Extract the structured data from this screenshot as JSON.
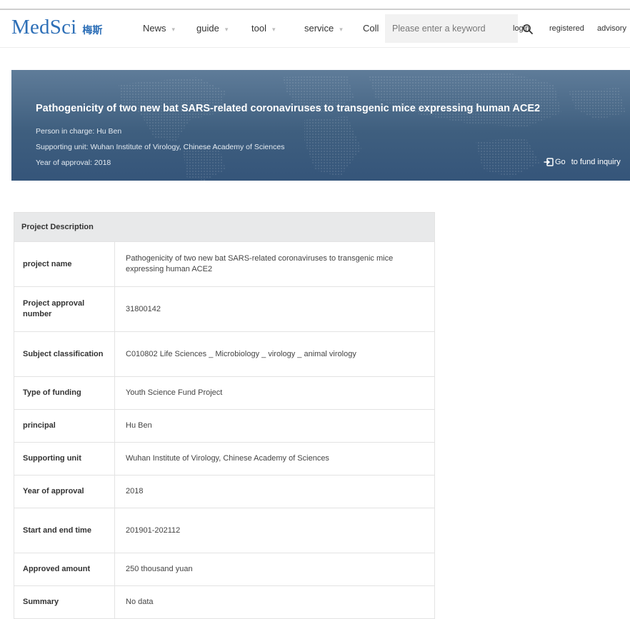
{
  "brand": {
    "name": "MedSci",
    "cn": "梅斯"
  },
  "nav": {
    "items": [
      {
        "label": "News",
        "caret": "▾"
      },
      {
        "label": "guide",
        "caret": "▾"
      },
      {
        "label": "tool",
        "caret": "▾"
      },
      {
        "label": "service",
        "caret": "▾"
      },
      {
        "label": "Coll",
        "caret": ""
      }
    ]
  },
  "search": {
    "placeholder": "Please enter a keyword",
    "value": ""
  },
  "header_links": {
    "login": "login",
    "register": "registered",
    "advisory": "advisory"
  },
  "banner": {
    "title": "Pathogenicity of two new bat SARS-related coronaviruses to transgenic mice expressing human ACE2",
    "person": "Person in charge: Hu Ben",
    "unit": "Supporting unit: Wuhan Institute of Virology, Chinese Academy of Sciences",
    "year": "Year of approval: 2018",
    "fund_go": "Go",
    "fund_rest": "to fund inquiry"
  },
  "description": {
    "header": "Project Description",
    "rows": [
      {
        "label": "project name",
        "value": "Pathogenicity of two new bat SARS-related coronaviruses to transgenic mice expressing human ACE2"
      },
      {
        "label": "Project approval number",
        "value": "31800142"
      },
      {
        "label": "Subject classification",
        "value": "C010802 Life Sciences _ Microbiology _ virology _ animal virology"
      },
      {
        "label": "Type of funding",
        "value": "Youth Science Fund Project"
      },
      {
        "label": "principal",
        "value": "Hu Ben"
      },
      {
        "label": "Supporting unit",
        "value": "Wuhan Institute of Virology, Chinese Academy of Sciences"
      },
      {
        "label": "Year of approval",
        "value": "2018"
      },
      {
        "label": "Start and end time",
        "value": "201901-202112"
      },
      {
        "label": "Approved amount",
        "value": "250 thousand yuan"
      },
      {
        "label": "Summary",
        "value": "No data"
      }
    ]
  }
}
